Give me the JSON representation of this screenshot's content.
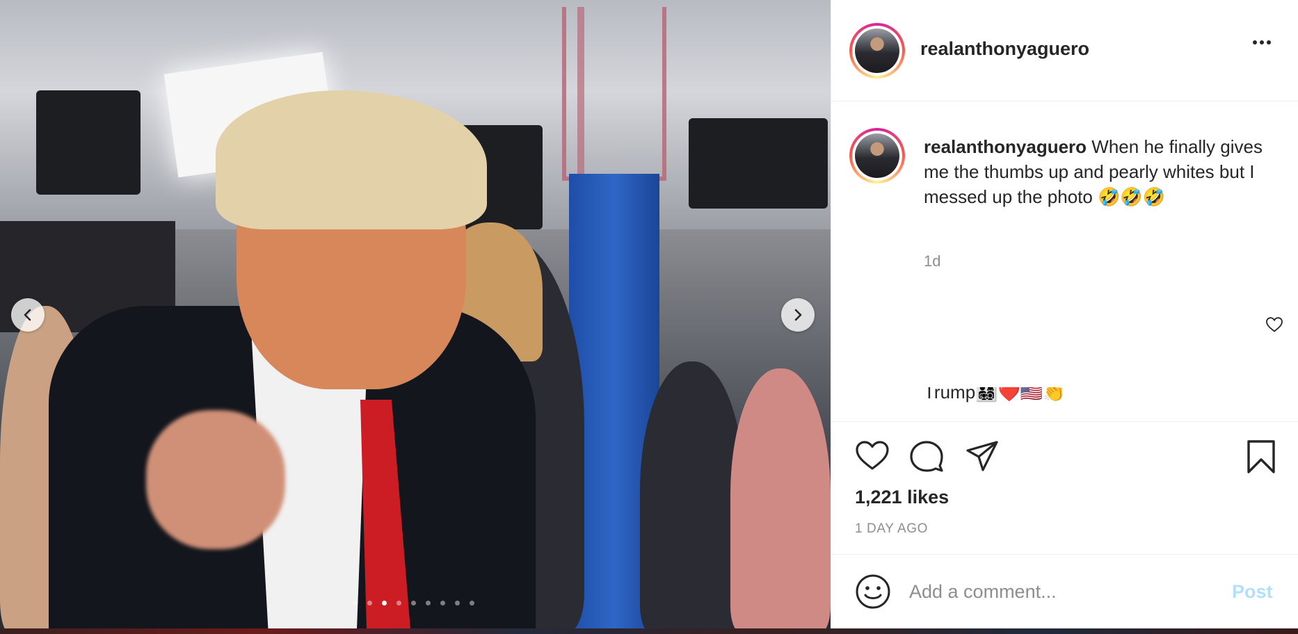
{
  "post": {
    "username": "realanthonyaguero",
    "caption_user": "realanthonyaguero",
    "caption_text": "When he finally gives me the thumbs up and pearly whites but I messed up the photo 🤣🤣🤣",
    "caption_age": "1d",
    "partial_comment": "Trump👨‍👩‍👧‍👦❤️🇺🇸👏",
    "likes": "1,221 likes",
    "posted_ago": "1 DAY AGO"
  },
  "composer": {
    "placeholder": "Add a comment...",
    "post_label": "Post"
  },
  "carousel": {
    "slide_count": 9,
    "active_index": 2
  },
  "icons": {
    "prev": "chevron-left-icon",
    "next": "chevron-right-icon",
    "more": "more-options-icon",
    "like": "heart-icon",
    "comment": "comment-icon",
    "share": "paper-plane-icon",
    "save": "bookmark-icon",
    "emoji": "smiley-icon"
  },
  "colors": {
    "accent_post_disabled": "#b2dffc",
    "text_primary": "#262626",
    "text_secondary": "#8e8e8e"
  }
}
